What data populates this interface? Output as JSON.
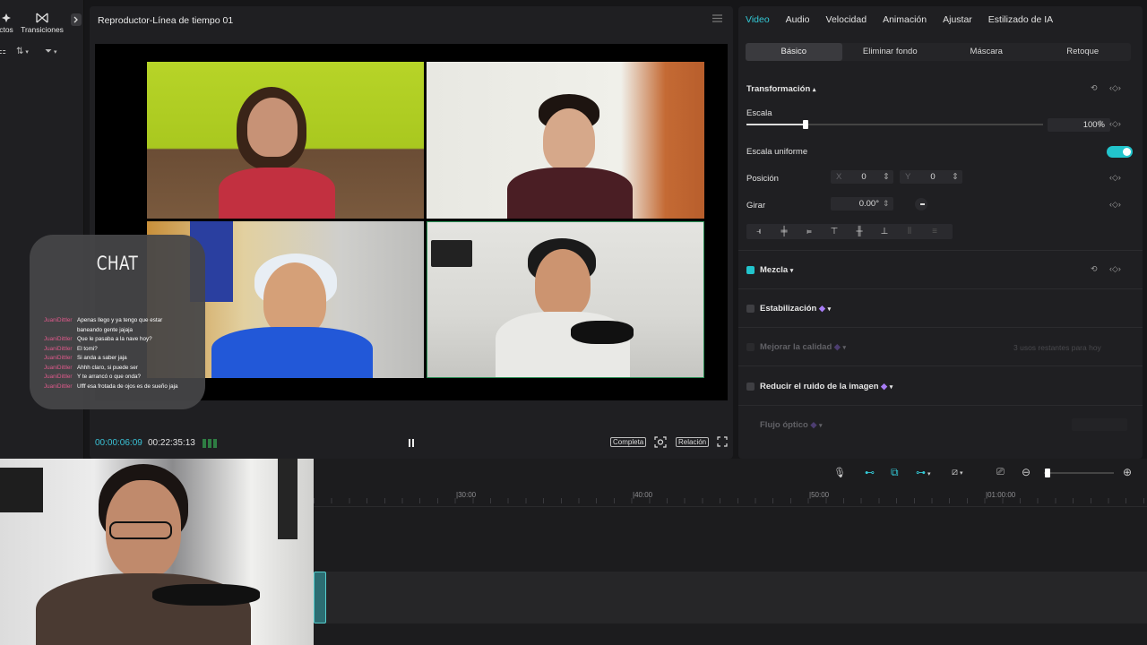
{
  "left_panel": {
    "tab_effects": "ctos",
    "tab_transitions": "Transiciones"
  },
  "player": {
    "title": "Reproductor-Línea de tiempo 01",
    "time_current": "00:00:06:09",
    "time_total": "00:22:35:13",
    "btn_full": "Completa",
    "btn_ratio": "Relación"
  },
  "chat": {
    "title": "CHAT",
    "messages": [
      {
        "user": "JuaniDittler",
        "text": "Apenas llego y ya tengo que estar"
      },
      {
        "user": "",
        "text": "baneando gente jajaja"
      },
      {
        "user": "JuaniDittler",
        "text": "Que le pasaba a la nave hoy?"
      },
      {
        "user": "JuaniDittler",
        "text": "El tomi?"
      },
      {
        "user": "JuaniDittler",
        "text": "Si anda a saber jaja"
      },
      {
        "user": "JuaniDittler",
        "text": "Ahhh claro, si puede ser"
      },
      {
        "user": "JuaniDittler",
        "text": "Y te arrancó o que onda?"
      },
      {
        "user": "JuaniDittler",
        "text": "Ufff esa frotada de ojos es de sueño jaja"
      }
    ]
  },
  "inspector": {
    "tabs": [
      "Video",
      "Audio",
      "Velocidad",
      "Animación",
      "Ajustar",
      "Estilizado de IA"
    ],
    "active_tab": "Video",
    "subtabs": [
      "Básico",
      "Eliminar fondo",
      "Máscara",
      "Retoque"
    ],
    "active_subtab": "Básico",
    "transform": {
      "section": "Transformación",
      "scale_label": "Escala",
      "scale_value": "100%",
      "scale_level": 0.2,
      "uniform_label": "Escala uniforme",
      "position_label": "Posición",
      "x_label": "X",
      "x_value": "0",
      "y_label": "Y",
      "y_value": "0",
      "rotate_label": "Girar",
      "rotate_value": "0.00°"
    },
    "blend_label": "Mezcla",
    "stabilize_label": "Estabilización",
    "enhance_label": "Mejorar la calidad",
    "enhance_note": "3 usos restantes para hoy",
    "denoise_label": "Reducir el ruido de la imagen",
    "optical_label": "Flujo óptico"
  },
  "timeline": {
    "ticks": [
      "|30:00",
      "|40:00",
      "|50:00",
      "|01:00:00"
    ],
    "zoom_level": 0.05
  },
  "colors": {
    "accent": "#33c9d6",
    "chat_user": "#e05a8c",
    "bg": "#1f1f22"
  }
}
